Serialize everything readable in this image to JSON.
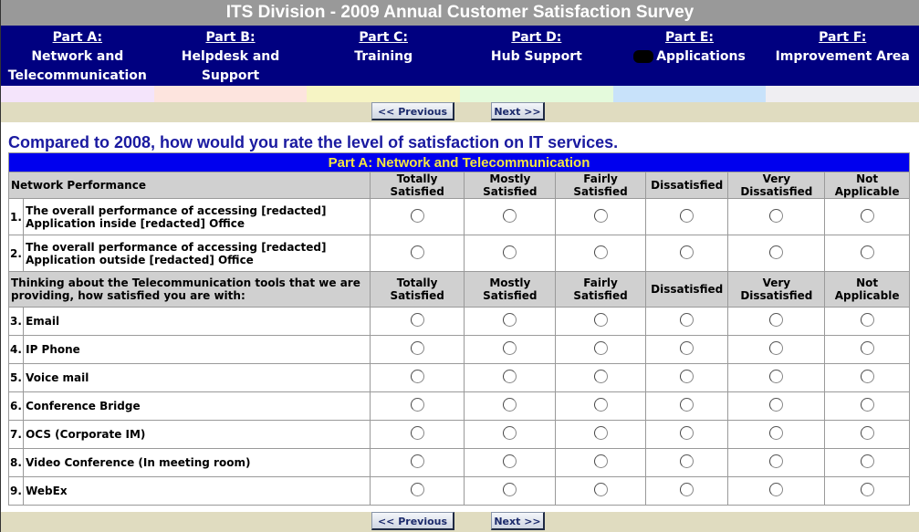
{
  "title": "ITS Division - 2009 Annual Customer Satisfaction Survey",
  "nav": [
    {
      "part": "Part A:",
      "label": "Network and Telecommunication",
      "redacted": false
    },
    {
      "part": "Part B:",
      "label": "Helpdesk and Support",
      "redacted": false
    },
    {
      "part": "Part C:",
      "label": "Training",
      "redacted": false
    },
    {
      "part": "Part D:",
      "label": "Hub Support",
      "redacted": false
    },
    {
      "part": "Part E:",
      "label": "Applications",
      "redacted": true
    },
    {
      "part": "Part F:",
      "label": "Improvement Area",
      "redacted": false
    }
  ],
  "strip_colors": [
    "#f4e4fb",
    "#fde4de",
    "#f6f4c4",
    "#e4fadc",
    "#c8e2fa",
    "#efeef2"
  ],
  "buttons": {
    "previous": "<< Previous",
    "next": "Next >>"
  },
  "question": "Compared to 2008, how would you rate the level of satisfaction on IT services.",
  "section_title": "Part A: Network and Telecommunication",
  "columns": [
    "Totally Satisfied",
    "Mostly Satisfied",
    "Fairly Satisfied",
    "Dissatisfied",
    "Very Dissatisfied",
    "Not Applicable"
  ],
  "group1": {
    "heading": "Network Performance",
    "items": [
      {
        "num": "1.",
        "text": "The overall performance of accessing [redacted] Application inside [redacted] Office"
      },
      {
        "num": "2.",
        "text": "The overall performance of accessing [redacted] Application outside [redacted] Office"
      }
    ]
  },
  "group2": {
    "heading": "Thinking about the Telecommunication tools that we are providing, how satisfied you are with:",
    "items": [
      {
        "num": "3.",
        "text": "Email"
      },
      {
        "num": "4.",
        "text": "IP Phone"
      },
      {
        "num": "5.",
        "text": "Voice mail"
      },
      {
        "num": "6.",
        "text": "Conference Bridge"
      },
      {
        "num": "7.",
        "text": "OCS (Corporate IM)"
      },
      {
        "num": "8.",
        "text": "Video Conference (In meeting room)"
      },
      {
        "num": "9.",
        "text": "WebEx"
      }
    ]
  }
}
